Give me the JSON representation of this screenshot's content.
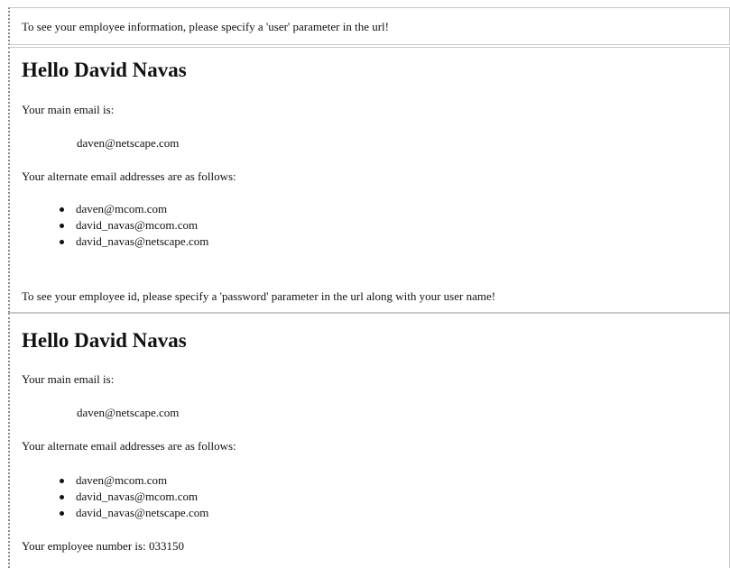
{
  "top_frame": {
    "notice": "To see your employee information, please specify a 'user' parameter in the url!"
  },
  "middle_frame": {
    "greeting": "Hello David Navas",
    "main_email_label": "Your main email is:",
    "main_email": "daven@netscape.com",
    "alt_label": "Your alternate email addresses are as follows:",
    "alt_emails": [
      "daven@mcom.com",
      "david_navas@mcom.com",
      "david_navas@netscape.com"
    ],
    "password_note": "To see your employee id, please specify a 'password' parameter in the url along with your user name!"
  },
  "bottom_frame": {
    "greeting": "Hello David Navas",
    "main_email_label": "Your main email is:",
    "main_email": "daven@netscape.com",
    "alt_label": "Your alternate email addresses are as follows:",
    "alt_emails": [
      "daven@mcom.com",
      "david_navas@mcom.com",
      "david_navas@netscape.com"
    ],
    "employee_number_label": "Your employee number is:",
    "employee_number": "033150"
  }
}
